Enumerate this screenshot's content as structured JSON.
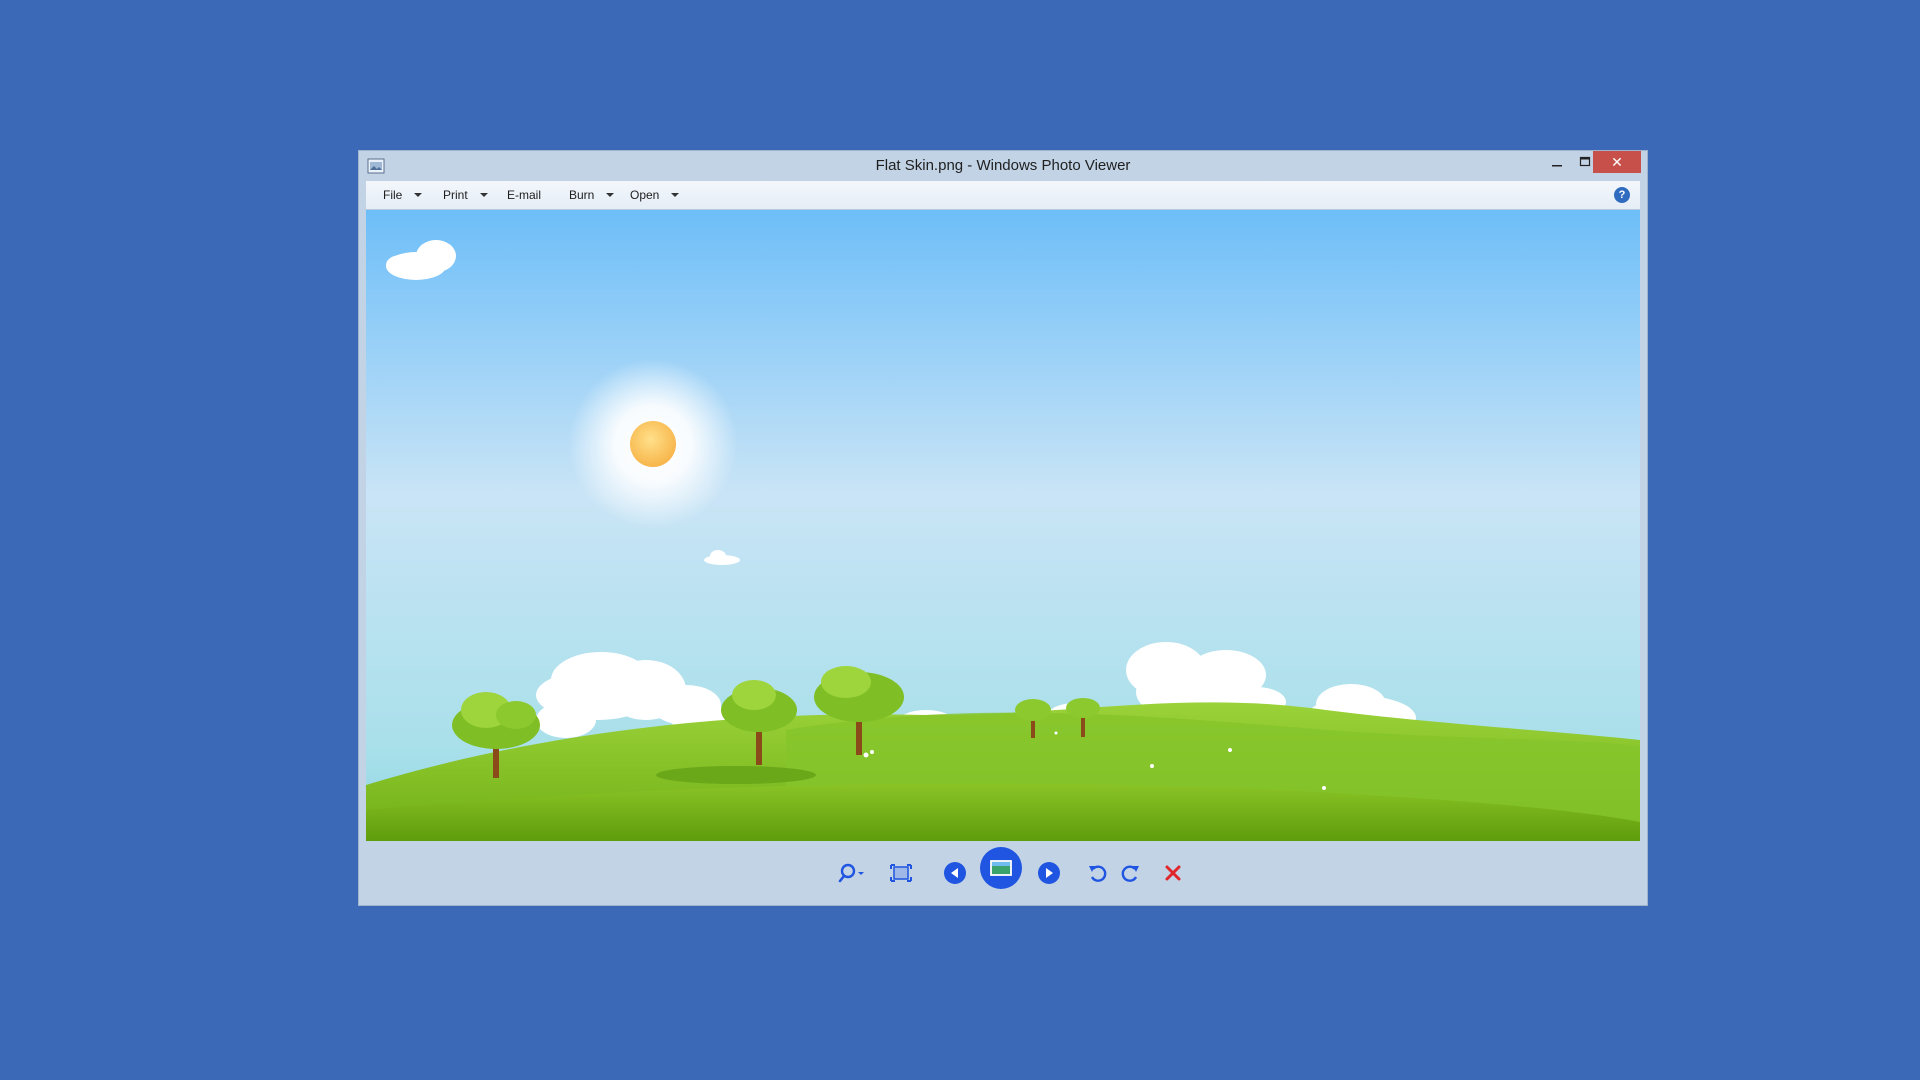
{
  "window": {
    "title": "Flat Skin.png - Windows Photo Viewer",
    "close_glyph": "✕"
  },
  "menu": {
    "items": [
      {
        "label": "File",
        "has_dropdown": true
      },
      {
        "label": "Print",
        "has_dropdown": true
      },
      {
        "label": "E-mail",
        "has_dropdown": false
      },
      {
        "label": "Burn",
        "has_dropdown": true
      },
      {
        "label": "Open",
        "has_dropdown": true
      }
    ],
    "help_glyph": "?"
  },
  "image": {
    "description_icon": "landscape-image",
    "sky_top_color": "#6dbef8",
    "sky_bottom_color": "#b8e4ee",
    "grass_color": "#7fbf20"
  },
  "toolbar": {
    "icons": [
      "zoom-icon",
      "actual-size-icon",
      "previous-icon",
      "slideshow-icon",
      "next-icon",
      "rotate-counterclockwise-icon",
      "rotate-clockwise-icon",
      "delete-icon"
    ],
    "accent_color": "#1f55e0",
    "delete_color": "#e0262b"
  }
}
